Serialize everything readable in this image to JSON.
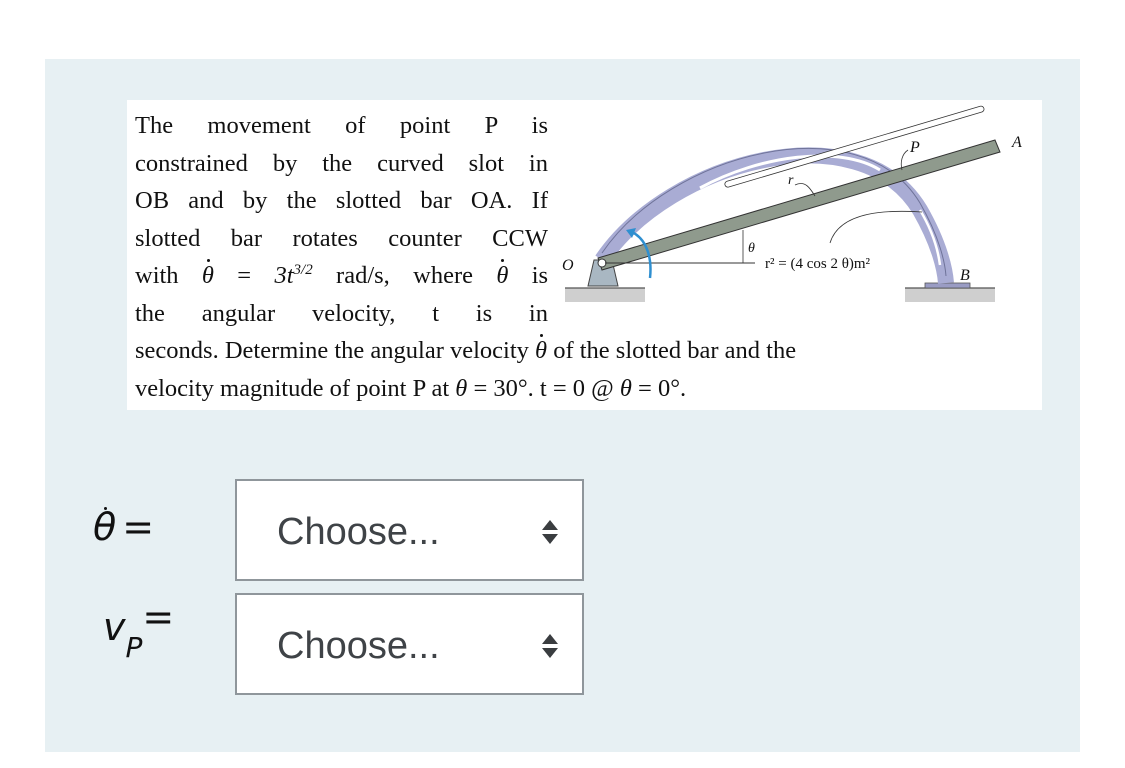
{
  "question": {
    "narrow_lines": [
      "The movement of point P is",
      "constrained by the curved slot in",
      "OB and by the slotted bar OA. If",
      "slotted bar rotates counter CCW"
    ],
    "with_prefix": "with",
    "theta_dot_symbol": "θ",
    "equals": "=",
    "rate_expr_base": "3t",
    "rate_expr_exp": "3/2",
    "rate_units_where": "rad/s, where",
    "is_word": "is",
    "line6": "the angular velocity, t is in",
    "line7_a": "seconds. Determine the angular velocity",
    "line7_b": "of the slotted bar and the",
    "line8_a": "velocity magnitude of point P at",
    "line8_theta": "θ",
    "line8_b": "= 30°. t = 0 @",
    "line8_c": "= 0°."
  },
  "figure": {
    "labels": {
      "O": "O",
      "A": "A",
      "B": "B",
      "P": "P",
      "r": "r",
      "theta": "θ",
      "equation": "r² = (4 cos 2 θ)m²"
    },
    "colors": {
      "curved_slot": "#a9acd4",
      "bar": "#8f9a8d",
      "arrow": "#2f8fd0",
      "ground": "#b8b8b8"
    }
  },
  "answers": [
    {
      "label_symbol": "θ",
      "label_suffix": "=",
      "select_value": "Choose..."
    },
    {
      "label_symbol": "v",
      "label_sub": "P",
      "label_suffix": "=",
      "select_value": "Choose..."
    }
  ]
}
